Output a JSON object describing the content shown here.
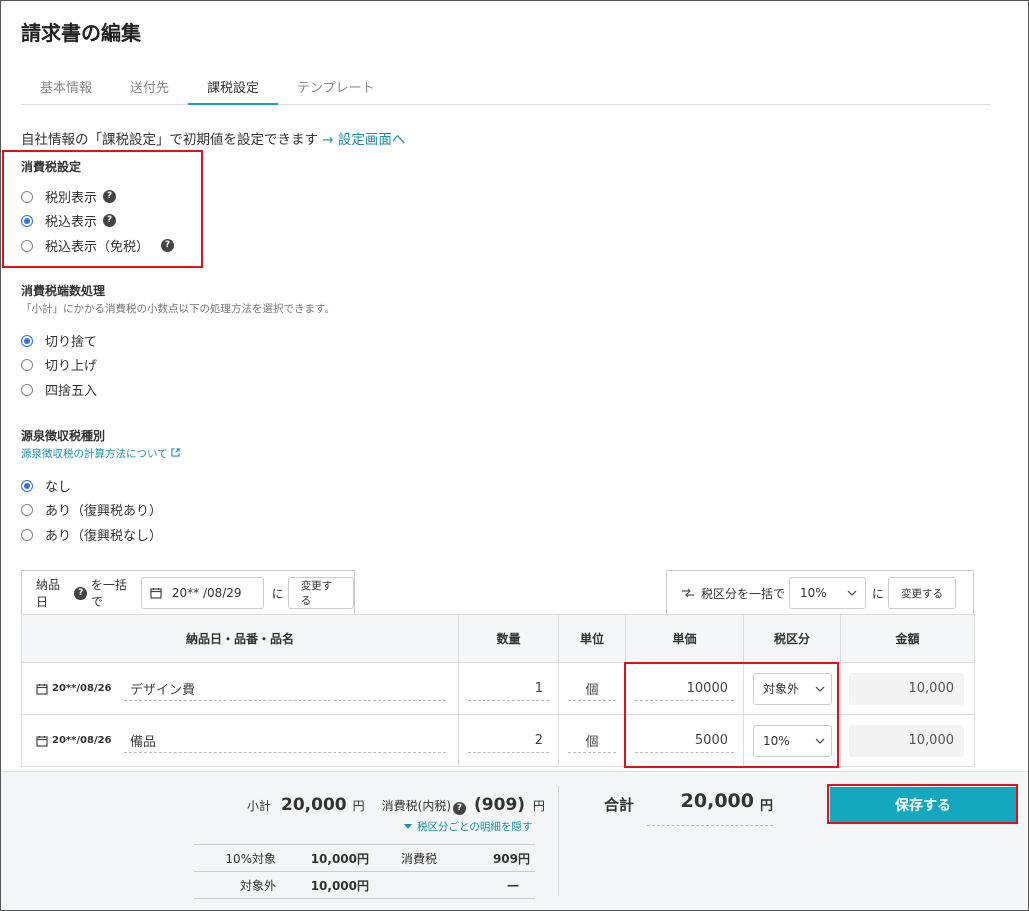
{
  "page": {
    "title": "請求書の編集"
  },
  "tabs": [
    {
      "label": "基本情報"
    },
    {
      "label": "送付先"
    },
    {
      "label": "課税設定",
      "active": true
    },
    {
      "label": "テンプレート"
    }
  ],
  "info": {
    "text": "自社情報の「課税設定」で初期値を設定できます",
    "link": "→ 設定画面へ"
  },
  "tax_setting": {
    "title": "消費税設定",
    "options": [
      "税別表示",
      "税込表示",
      "税込表示（免税）"
    ],
    "selected": "税込表示"
  },
  "rounding": {
    "title": "消費税端数処理",
    "description": "「小計」にかかる消費税の小数点以下の処理方法を選択できます。",
    "options": [
      "切り捨て",
      "切り上げ",
      "四捨五入"
    ],
    "selected": "切り捨て"
  },
  "withholding": {
    "title": "源泉徴収税種別",
    "link": "源泉徴収税の計算方法について",
    "options": [
      "なし",
      "あり（復興税あり）",
      "あり（復興税なし）"
    ],
    "selected": "なし"
  },
  "bulk_date": {
    "label": "納品日",
    "suffix": "を一括で",
    "date_value": "20** /08/29",
    "particle": "に",
    "button": "変更する"
  },
  "bulk_tax": {
    "label": "税区分を一括で",
    "value": "10%",
    "particle": "に",
    "button": "変更する"
  },
  "table": {
    "headers": [
      "納品日・品番・品名",
      "数量",
      "単位",
      "単価",
      "税区分",
      "金額"
    ],
    "rows": [
      {
        "date": "20**/08/26",
        "name": "デザイン費",
        "qty": "1",
        "unit": "個",
        "price": "10000",
        "tax": "対象外",
        "amount": "10,000"
      },
      {
        "date": "20**/08/26",
        "name": "備品",
        "qty": "2",
        "unit": "個",
        "price": "5000",
        "tax": "10%",
        "amount": "10,000"
      }
    ]
  },
  "footer": {
    "subtotal_label": "小計",
    "subtotal_value": "20,000",
    "yen": "円",
    "tax_label": "消費税(内税)",
    "tax_value": "(909)",
    "toggle_link": "税区分ごとの明細を隠す",
    "breakdown": [
      {
        "label": "10%対象",
        "amount": "10,000円",
        "tax_label": "消費税",
        "tax_amount": "909円"
      },
      {
        "label": "対象外",
        "amount": "10,000円",
        "tax_label": "",
        "tax_amount": "—"
      }
    ],
    "total_label": "合計",
    "total_value": "20,000",
    "save_button": "保存する"
  },
  "colors": {
    "accent": "#14a8bf",
    "link": "#1a8fa6",
    "highlight": "#e0111b",
    "radio": "#2d6ff0"
  }
}
